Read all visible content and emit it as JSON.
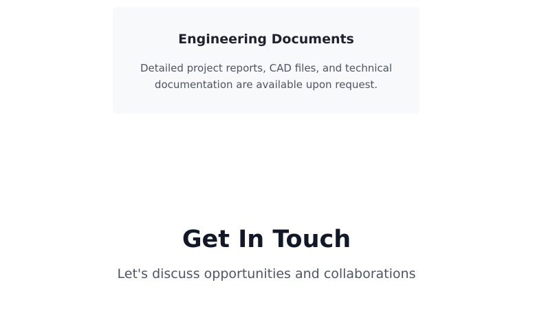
{
  "card": {
    "title": "Engineering Documents",
    "description": "Detailed project reports, CAD files, and technical documentation are available upon request."
  },
  "contact": {
    "title": "Get In Touch",
    "subtitle": "Let's discuss opportunities and collaborations"
  },
  "colors": {
    "card_bg": "#f8f9fa",
    "heading": "#111827",
    "body_text": "#4b5563"
  }
}
